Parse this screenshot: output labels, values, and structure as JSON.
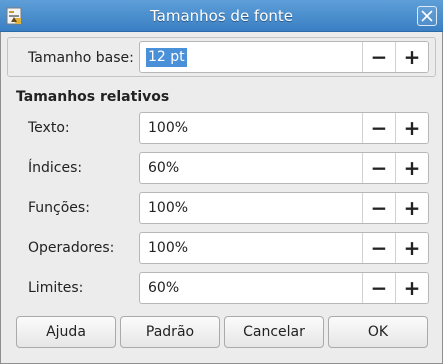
{
  "window": {
    "title": "Tamanhos de fonte"
  },
  "base": {
    "label": "Tamanho base:",
    "value": "12 pt"
  },
  "relative": {
    "heading": "Tamanhos relativos",
    "rows": [
      {
        "label": "Texto:",
        "value": "100%"
      },
      {
        "label": "Índices:",
        "value": "60%"
      },
      {
        "label": "Funções:",
        "value": "100%"
      },
      {
        "label": "Operadores:",
        "value": "100%"
      },
      {
        "label": "Limites:",
        "value": "60%"
      }
    ]
  },
  "stepper": {
    "minus": "−",
    "plus": "+"
  },
  "buttons": {
    "help": "Ajuda",
    "default": "Padrão",
    "cancel": "Cancelar",
    "ok": "OK"
  }
}
